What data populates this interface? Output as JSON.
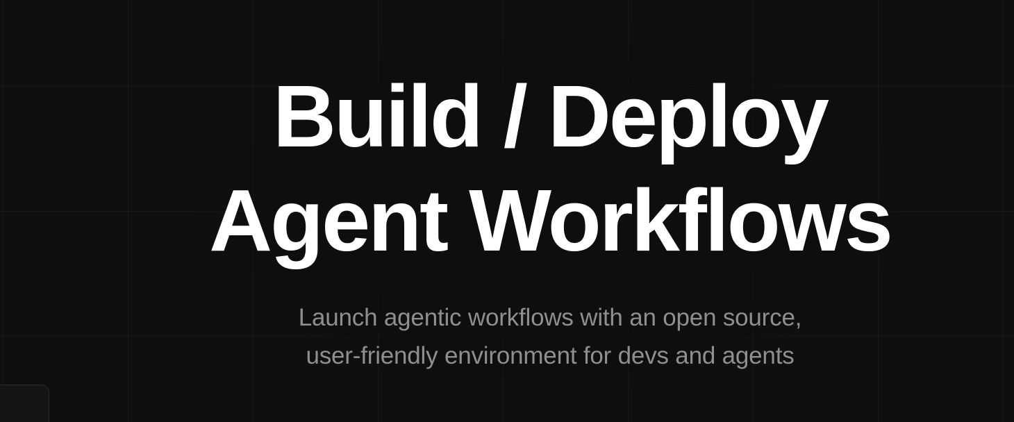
{
  "hero": {
    "title_line1": "Build / Deploy",
    "title_line2": "Agent Workflows",
    "subtitle_line1": "Launch agentic workflows with an open source,",
    "subtitle_line2": "user-friendly environment for devs and agents"
  },
  "colors": {
    "background": "#0f0f0f",
    "title": "#ffffff",
    "subtitle": "#8f8f8f"
  }
}
